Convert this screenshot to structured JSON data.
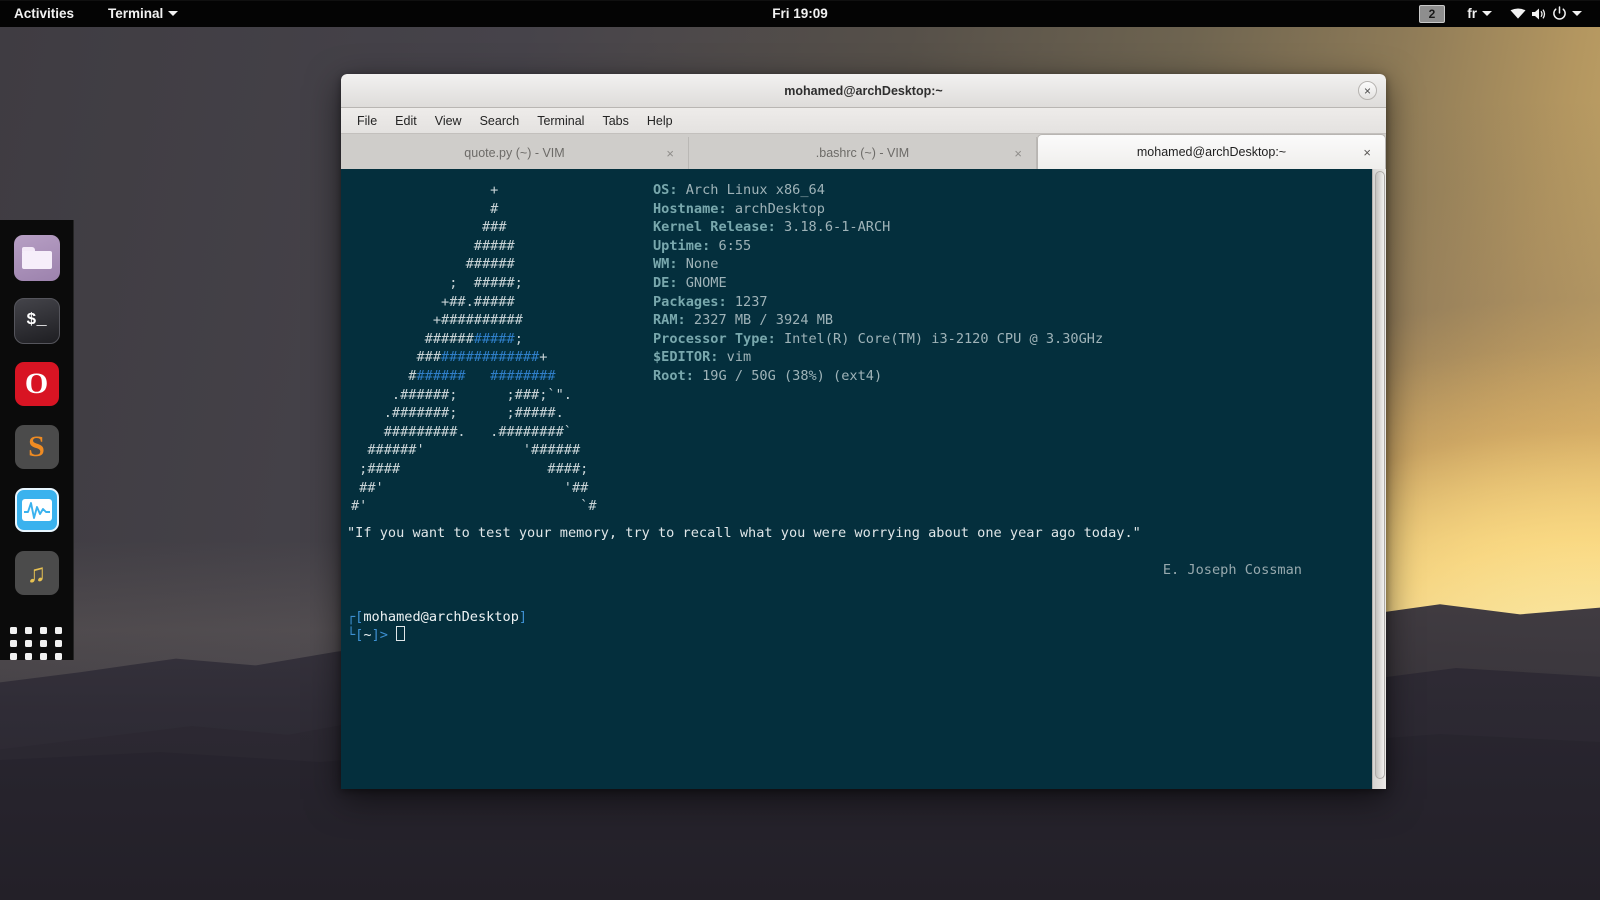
{
  "topbar": {
    "activities": "Activities",
    "app_name": "Terminal",
    "clock": "Fri 19:09",
    "workspace": "2",
    "keyboard_layout": "fr",
    "icons": [
      "wifi-icon",
      "volume-icon",
      "power-icon",
      "chevron-down-icon"
    ]
  },
  "dock": {
    "items": [
      {
        "name": "files",
        "label": "Files"
      },
      {
        "name": "terminal",
        "label": "$_"
      },
      {
        "name": "opera",
        "label": "O"
      },
      {
        "name": "sublime-text",
        "label": "S"
      },
      {
        "name": "system-monitor",
        "label": "System Monitor"
      },
      {
        "name": "music",
        "label": "♫"
      }
    ],
    "show_applications": "Show Applications"
  },
  "window": {
    "title": "mohamed@archDesktop:~",
    "close_label": "×",
    "menu": [
      "File",
      "Edit",
      "View",
      "Search",
      "Terminal",
      "Tabs",
      "Help"
    ],
    "tabs": [
      {
        "label": "quote.py (~) - VIM",
        "active": false,
        "close": "×"
      },
      {
        "label": ".bashrc (~) - VIM",
        "active": false,
        "close": "×"
      },
      {
        "label": "mohamed@archDesktop:~",
        "active": true,
        "close": "×"
      }
    ]
  },
  "terminal": {
    "background": "#042f3d",
    "ascii_logo": "                 +\n                 #\n                ###\n               #####\n              ######\n            ;  #####;\n           +##.#####\n          +##########\n         ######[[[#####]];\n        ###[[[############]]+\n       #[[######   ########\n     .######;      ;###;`\".\n    .#######;      ;#####.\n    #########.   .########`\n  ######'            '######\n ;####                  ####;\n ##'                      '##\n#'                          `#",
    "info": [
      {
        "key": "OS:",
        "value": "Arch Linux x86_64"
      },
      {
        "key": "Hostname:",
        "value": "archDesktop"
      },
      {
        "key": "Kernel Release:",
        "value": "3.18.6-1-ARCH"
      },
      {
        "key": "Uptime:",
        "value": "6:55"
      },
      {
        "key": "WM:",
        "value": "None"
      },
      {
        "key": "DE:",
        "value": "GNOME"
      },
      {
        "key": "Packages:",
        "value": "1237"
      },
      {
        "key": "RAM:",
        "value": "2327 MB / 3924 MB"
      },
      {
        "key": "Processor Type:",
        "value": "Intel(R) Core(TM) i3-2120 CPU @ 3.30GHz"
      },
      {
        "key": "$EDITOR:",
        "value": "vim"
      },
      {
        "key": "Root:",
        "value": "19G / 50G (38%) (ext4)"
      }
    ],
    "quote": "\"If you want to test your memory, try to recall what you were worrying about one year ago today.\"",
    "quote_author": "E. Joseph Cossman",
    "prompt_line1_bracket_open": "┌[",
    "prompt_line1_user": "mohamed@archDesktop",
    "prompt_line1_bracket_close": "]",
    "prompt_line2_bracket_open": "└[",
    "prompt_line2_path": "~",
    "prompt_line2_bracket_close": "]>",
    "key_color": "#79a8ad",
    "value_color": "#9fb3b8",
    "prompt_color": "#3d8fd1"
  }
}
